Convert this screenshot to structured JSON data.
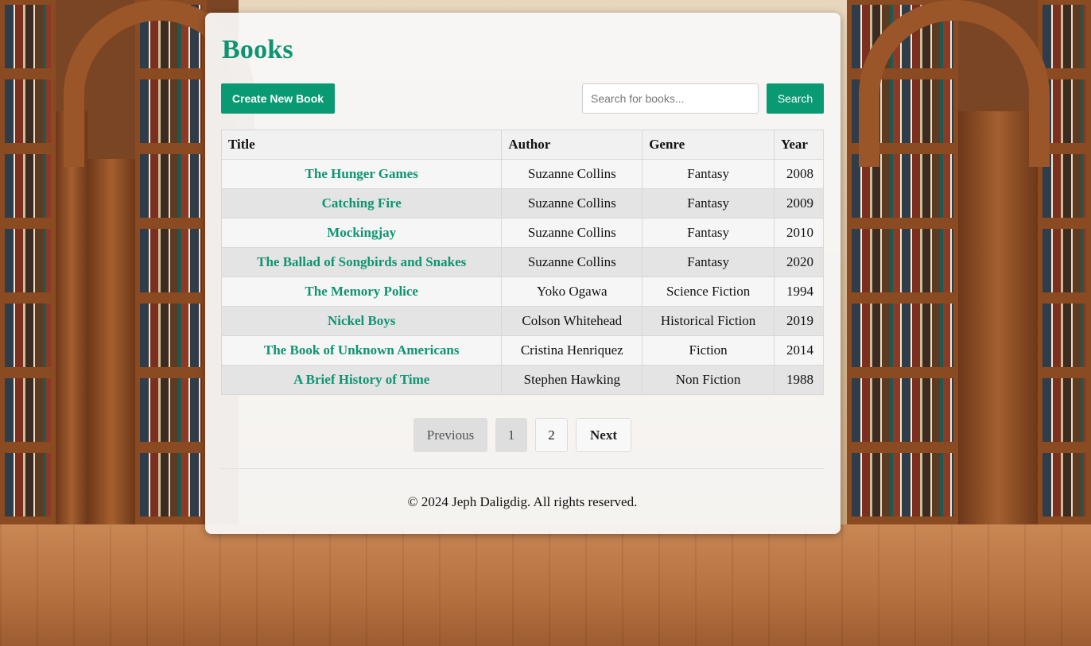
{
  "page": {
    "title": "Books"
  },
  "toolbar": {
    "create_label": "Create New Book",
    "search_placeholder": "Search for books...",
    "search_value": "",
    "search_label": "Search"
  },
  "table": {
    "headers": [
      "Title",
      "Author",
      "Genre",
      "Year"
    ],
    "rows": [
      {
        "title": "The Hunger Games",
        "author": "Suzanne Collins",
        "genre": "Fantasy",
        "year": "2008"
      },
      {
        "title": "Catching Fire",
        "author": "Suzanne Collins",
        "genre": "Fantasy",
        "year": "2009"
      },
      {
        "title": "Mockingjay",
        "author": "Suzanne Collins",
        "genre": "Fantasy",
        "year": "2010"
      },
      {
        "title": "The Ballad of Songbirds and Snakes",
        "author": "Suzanne Collins",
        "genre": "Fantasy",
        "year": "2020"
      },
      {
        "title": "The Memory Police",
        "author": "Yoko Ogawa",
        "genre": "Science Fiction",
        "year": "1994"
      },
      {
        "title": "Nickel Boys",
        "author": "Colson Whitehead",
        "genre": "Historical Fiction",
        "year": "2019"
      },
      {
        "title": "The Book of Unknown Americans",
        "author": "Cristina Henriquez",
        "genre": "Fiction",
        "year": "2014"
      },
      {
        "title": "A Brief History of Time",
        "author": "Stephen Hawking",
        "genre": "Non Fiction",
        "year": "1988"
      }
    ]
  },
  "pagination": {
    "previous_label": "Previous",
    "pages": [
      "1",
      "2"
    ],
    "current_page": "1",
    "next_label": "Next"
  },
  "footer": {
    "text": "© 2024 Jeph Daligdig. All rights reserved."
  },
  "colors": {
    "accent": "#099a73",
    "title": "#0f9471"
  }
}
